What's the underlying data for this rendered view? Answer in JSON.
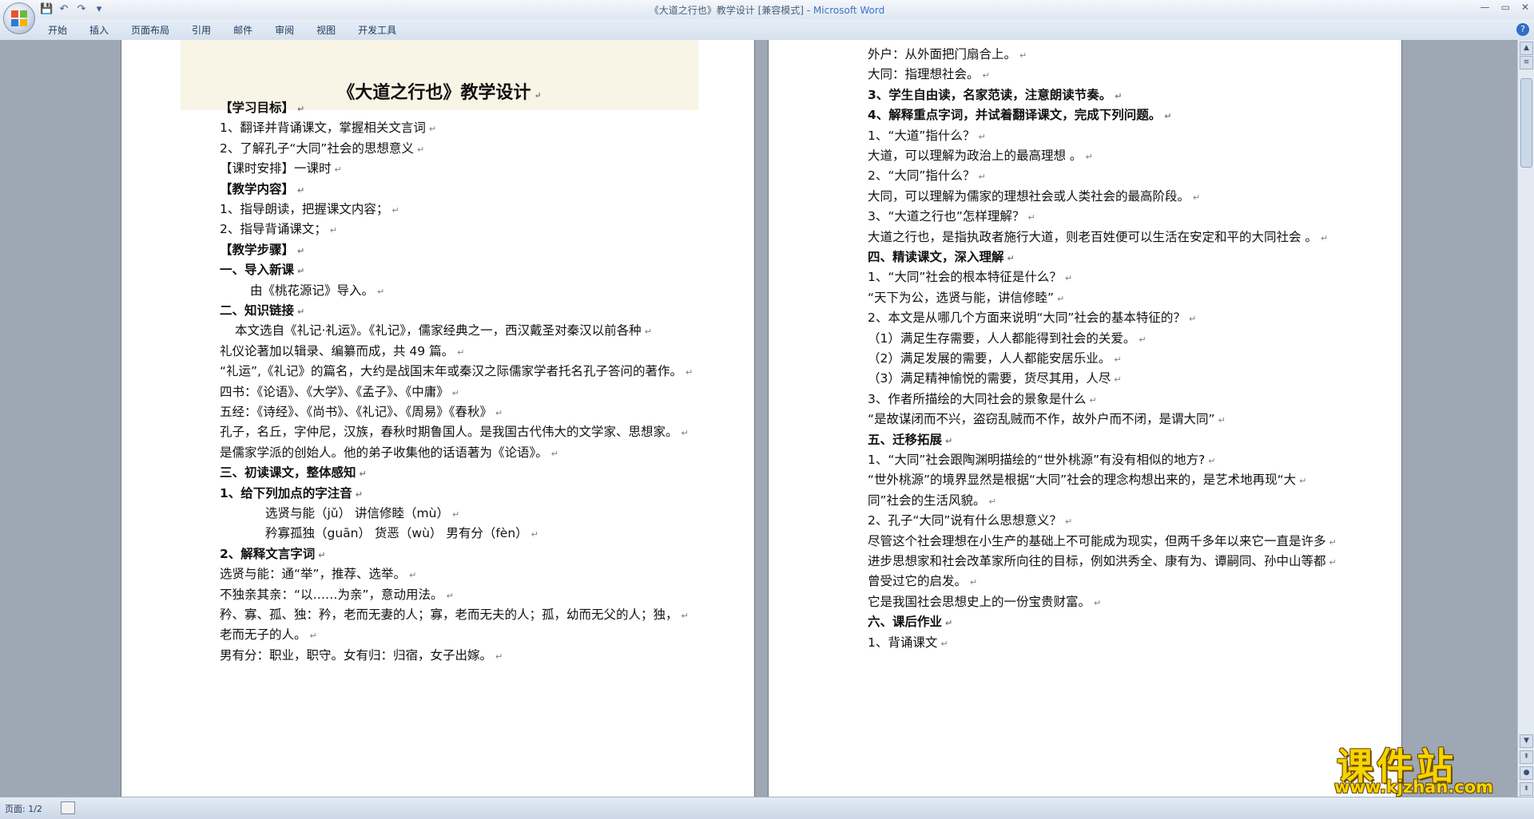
{
  "window": {
    "title": "《大道之行也》教学设计 [兼容模式] - ",
    "app_name": "Microsoft Word",
    "controls": [
      "—",
      "▭",
      "✕"
    ]
  },
  "quick_access": {
    "icons": [
      "save-icon",
      "undo-icon",
      "redo-icon",
      "customize-icon"
    ],
    "glyphs": [
      "💾",
      "↶",
      "↷",
      "▾"
    ]
  },
  "ribbon": {
    "tabs": [
      "开始",
      "插入",
      "页面布局",
      "引用",
      "邮件",
      "审阅",
      "视图",
      "开发工具"
    ],
    "help": "?"
  },
  "page1": {
    "title": "《大道之行也》教学设计",
    "lines": [
      {
        "text": "【学习目标】",
        "bold": true,
        "indent": 0
      },
      {
        "text": "1、翻译并背诵课文，掌握相关文言词",
        "bold": false,
        "indent": 0
      },
      {
        "text": "2、了解孔子“大同”社会的思想意义",
        "bold": false,
        "indent": 0
      },
      {
        "text": "【课时安排】一课时",
        "bold": false,
        "indent": 0
      },
      {
        "text": "【教学内容】",
        "bold": true,
        "indent": 0
      },
      {
        "text": "1、指导朗读，把握课文内容；",
        "bold": false,
        "indent": 0
      },
      {
        "text": "2、指导背诵课文；",
        "bold": false,
        "indent": 0
      },
      {
        "text": "【教学步骤】",
        "bold": true,
        "indent": 0
      },
      {
        "text": "一、导入新课",
        "bold": true,
        "indent": 0
      },
      {
        "text": "由《桃花源记》导入。",
        "bold": false,
        "indent": 2
      },
      {
        "text": "二、知识链接",
        "bold": true,
        "indent": 0
      },
      {
        "text": "本文选自《礼记·礼运》。《礼记》，儒家经典之一，西汉戴圣对秦汉以前各种",
        "bold": false,
        "indent": 1
      },
      {
        "text": "礼仪论著加以辑录、编纂而成，共 49 篇。",
        "bold": false,
        "indent": 0
      },
      {
        "text": "“礼运”,《礼记》的篇名，大约是战国末年或秦汉之际儒家学者托名孔子答问的著作。",
        "bold": false,
        "indent": 0
      },
      {
        "text": "四书：《论语》、《大学》、《孟子》、《中庸》",
        "bold": false,
        "indent": 0
      },
      {
        "text": "五经：《诗经》、《尚书》、《礼记》、《周易》《春秋》",
        "bold": false,
        "indent": 0
      },
      {
        "text": "孔子，名丘，字仲尼，汉族，春秋时期鲁国人。是我国古代伟大的文学家、思想家。",
        "bold": false,
        "indent": 0
      },
      {
        "text": "是儒家学派的创始人。他的弟子收集他的话语著为《论语》。",
        "bold": false,
        "indent": 0
      },
      {
        "text": "三、初读课文，整体感知",
        "bold": true,
        "indent": 0
      },
      {
        "text": "1、给下列加点的字注音",
        "bold": true,
        "indent": 0
      },
      {
        "text": "选贤与能（jǔ）    讲信修睦（mù）",
        "bold": false,
        "indent": 3
      },
      {
        "text": "矜寡孤独（guān）   货恶（wù）    男有分（fèn）",
        "bold": false,
        "indent": 3
      },
      {
        "text": "2、解释文言字词",
        "bold": true,
        "indent": 0
      },
      {
        "text": "选贤与能：通“举”，推荐、选举。",
        "bold": false,
        "indent": 0
      },
      {
        "text": "不独亲其亲：“以……为亲”，意动用法。",
        "bold": false,
        "indent": 0
      },
      {
        "text": "矜、寡、孤、独：矜，老而无妻的人；寡，老而无夫的人；孤，幼而无父的人；独，",
        "bold": false,
        "indent": 0
      },
      {
        "text": "老而无子的人。",
        "bold": false,
        "indent": 0
      },
      {
        "text": "男有分：职业，职守。女有归：归宿，女子出嫁。",
        "bold": false,
        "indent": 0
      }
    ]
  },
  "page2": {
    "lines": [
      {
        "text": "外户：从外面把门扇合上。",
        "bold": false
      },
      {
        "text": "大同：指理想社会。",
        "bold": false
      },
      {
        "text": "3、学生自由读，名家范读，注意朗读节奏。",
        "bold": true
      },
      {
        "text": "4、解释重点字词，并试着翻译课文，完成下列问题。",
        "bold": true
      },
      {
        "text": "1、“大道”指什么？",
        "bold": false
      },
      {
        "text": "大道，可以理解为政治上的最高理想 。",
        "bold": false
      },
      {
        "text": "2、“大同”指什么？",
        "bold": false
      },
      {
        "text": "大同，可以理解为儒家的理想社会或人类社会的最高阶段。",
        "bold": false
      },
      {
        "text": "3、“大道之行也”怎样理解？",
        "bold": false
      },
      {
        "text": "大道之行也，是指执政者施行大道，则老百姓便可以生活在安定和平的大同社会 。",
        "bold": false
      },
      {
        "text": "四、精读课文，深入理解",
        "bold": true
      },
      {
        "text": "1、“大同”社会的根本特征是什么？",
        "bold": false
      },
      {
        "text": "“天下为公，选贤与能，讲信修睦”",
        "bold": false
      },
      {
        "text": "2、本文是从哪几个方面来说明“大同”社会的基本特征的？",
        "bold": false
      },
      {
        "text": "（1）满足生存需要，人人都能得到社会的关爱。",
        "bold": false
      },
      {
        "text": "（2）满足发展的需要，人人都能安居乐业。",
        "bold": false
      },
      {
        "text": "（3）满足精神愉悦的需要，货尽其用，人尽",
        "bold": false
      },
      {
        "text": "3、作者所描绘的大同社会的景象是什么",
        "bold": false
      },
      {
        "text": "“是故谋闭而不兴，盗窃乱贼而不作，故外户而不闭，是谓大同”",
        "bold": false
      },
      {
        "text": "五、迁移拓展",
        "bold": true
      },
      {
        "text": "1、“大同”社会跟陶渊明描绘的“世外桃源”有没有相似的地方?",
        "bold": false
      },
      {
        "text": "“世外桃源”的境界显然是根据“大同”社会的理念构想出来的，是艺术地再现“大",
        "bold": false
      },
      {
        "text": "同”社会的生活风貌。",
        "bold": false
      },
      {
        "text": "2、孔子“大同”说有什么思想意义？",
        "bold": false
      },
      {
        "text": "尽管这个社会理想在小生产的基础上不可能成为现实，但两千多年以来它一直是许多",
        "bold": false
      },
      {
        "text": "进步思想家和社会改革家所向往的目标，例如洪秀全、康有为、谭嗣同、孙中山等都",
        "bold": false
      },
      {
        "text": "曾受过它的启发。",
        "bold": false
      },
      {
        "text": "它是我国社会思想史上的一份宝贵财富。",
        "bold": false
      },
      {
        "text": "六、课后作业",
        "bold": true
      },
      {
        "text": "1、背诵课文",
        "bold": false
      }
    ]
  },
  "status": {
    "page_label": "页面: 1/2"
  },
  "watermark": {
    "title": "课件站",
    "url": "www.kjzhan.com"
  },
  "colors": {
    "accent": "#3a74c5",
    "watermark": "#f7d300",
    "workspace": "#9ea7b4"
  }
}
